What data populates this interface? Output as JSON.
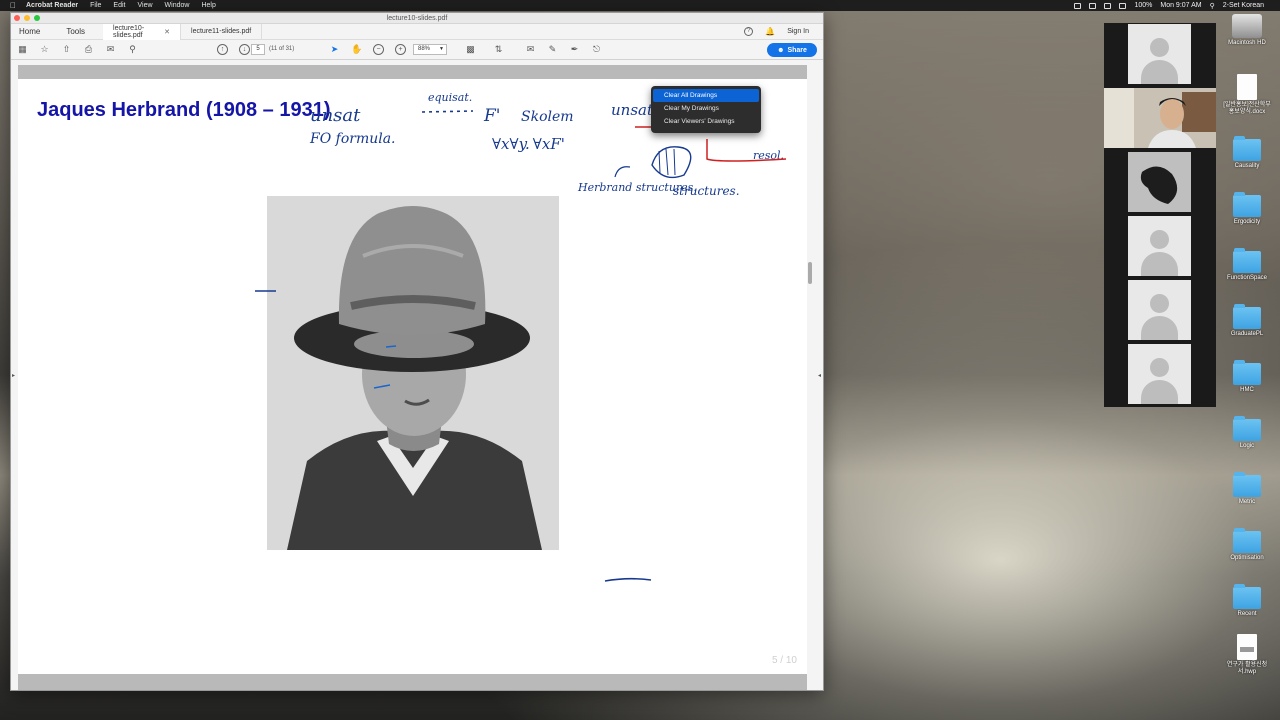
{
  "menubar": {
    "app_name": "Acrobat Reader",
    "items": [
      "File",
      "Edit",
      "View",
      "Window",
      "Help"
    ],
    "battery": "100%",
    "clock": "Mon 9:07 AM",
    "input_source": "2-Set Korean"
  },
  "window": {
    "title": "lecture10-slides.pdf",
    "nav_home": "Home",
    "nav_tools": "Tools",
    "tabs": [
      {
        "label": "lecture10-slides.pdf",
        "active": true
      },
      {
        "label": "lecture11-slides.pdf",
        "active": false
      }
    ],
    "sign_in": "Sign In"
  },
  "toolbar": {
    "page_input": "5",
    "page_of": "(11 of 31)",
    "zoom": "88%",
    "share_label": "Share"
  },
  "slide": {
    "title": "Jaques Herbrand (1908 – 1931)",
    "page_indicator": "5 / 10",
    "photo_alt": "Portrait of Jacques Herbrand wearing a bucket hat"
  },
  "annotations": {
    "ink_color": "#173a8f",
    "red_ink_color": "#d02020",
    "texts": [
      "unsat",
      "FO formula.",
      "equisat.",
      "F'",
      "Skolem",
      "unsat",
      "∀x∀y. ∀xF'",
      "Herbrand structures.",
      "structures.",
      "resol."
    ]
  },
  "context_menu": {
    "items": [
      {
        "label": "Clear All Drawings",
        "selected": true
      },
      {
        "label": "Clear My Drawings",
        "selected": false
      },
      {
        "label": "Clear Viewers' Drawings",
        "selected": false
      }
    ]
  },
  "zoom_participants": {
    "count": 6
  },
  "desktop_icons": [
    {
      "label": "Macintosh HD",
      "type": "drive"
    },
    {
      "label": "[일반홍보]전산학부 홍보양식.docx",
      "type": "doc"
    },
    {
      "label": "Causality",
      "type": "folder"
    },
    {
      "label": "Ergodicity",
      "type": "folder"
    },
    {
      "label": "FunctionSpace",
      "type": "folder"
    },
    {
      "label": "GraduatePL",
      "type": "folder"
    },
    {
      "label": "HMC",
      "type": "folder"
    },
    {
      "label": "Logic",
      "type": "folder"
    },
    {
      "label": "Metric",
      "type": "folder"
    },
    {
      "label": "Optimisation",
      "type": "folder"
    },
    {
      "label": "Recent",
      "type": "folder"
    },
    {
      "label": "연구가 활용신청서.hwp",
      "type": "doc"
    }
  ]
}
